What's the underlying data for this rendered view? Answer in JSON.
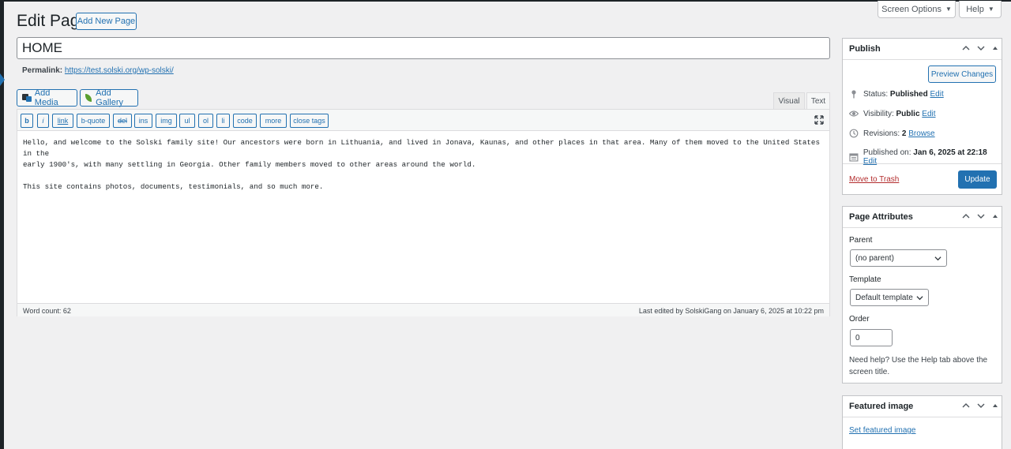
{
  "page": {
    "heading": "Edit Page",
    "add_new_label": "Add New Page",
    "screen_options_label": "Screen Options",
    "help_label": "Help"
  },
  "editor": {
    "title_value": "HOME",
    "permalink_label": "Permalink:",
    "permalink_url": "https://test.solski.org/wp-solski/",
    "add_media_label": "Add Media",
    "add_gallery_label": "Add Gallery",
    "tabs": [
      "Visual",
      "Text"
    ],
    "quicktags": [
      "b",
      "i",
      "link",
      "b-quote",
      "del",
      "ins",
      "img",
      "ul",
      "ol",
      "li",
      "code",
      "more",
      "close tags"
    ],
    "content": "Hello, and welcome to the Solski family site! Our ancestors were born in Lithuania, and lived in Jonava, Kaunas, and other places in that area. Many of them moved to the United States in the\nearly 1900's, with many settling in Georgia. Other family members moved to other areas around the world.\n\nThis site contains photos, documents, testimonials, and so much more.",
    "word_count": "Word count: 62",
    "last_edited": "Last edited by SolskiGang on January 6, 2025 at 10:22 pm"
  },
  "publish": {
    "title": "Publish",
    "preview_label": "Preview Changes",
    "status_label": "Status:",
    "status_value": "Published",
    "visibility_label": "Visibility:",
    "visibility_value": "Public",
    "revisions_label": "Revisions:",
    "revisions_value": "2",
    "browse_label": "Browse",
    "published_on_label": "Published on:",
    "published_on_value": "Jan 6, 2025 at 22:18",
    "edit_label": "Edit",
    "trash_label": "Move to Trash",
    "update_label": "Update"
  },
  "attributes": {
    "title": "Page Attributes",
    "parent_label": "Parent",
    "parent_value": "(no parent)",
    "template_label": "Template",
    "template_value": "Default template",
    "order_label": "Order",
    "order_value": "0",
    "help_text": "Need help? Use the Help tab above the screen title."
  },
  "featured": {
    "title": "Featured image",
    "set_link": "Set featured image"
  },
  "colors": {
    "accent": "#2271b1",
    "background": "#f0f0f1",
    "danger": "#b32d2e"
  }
}
